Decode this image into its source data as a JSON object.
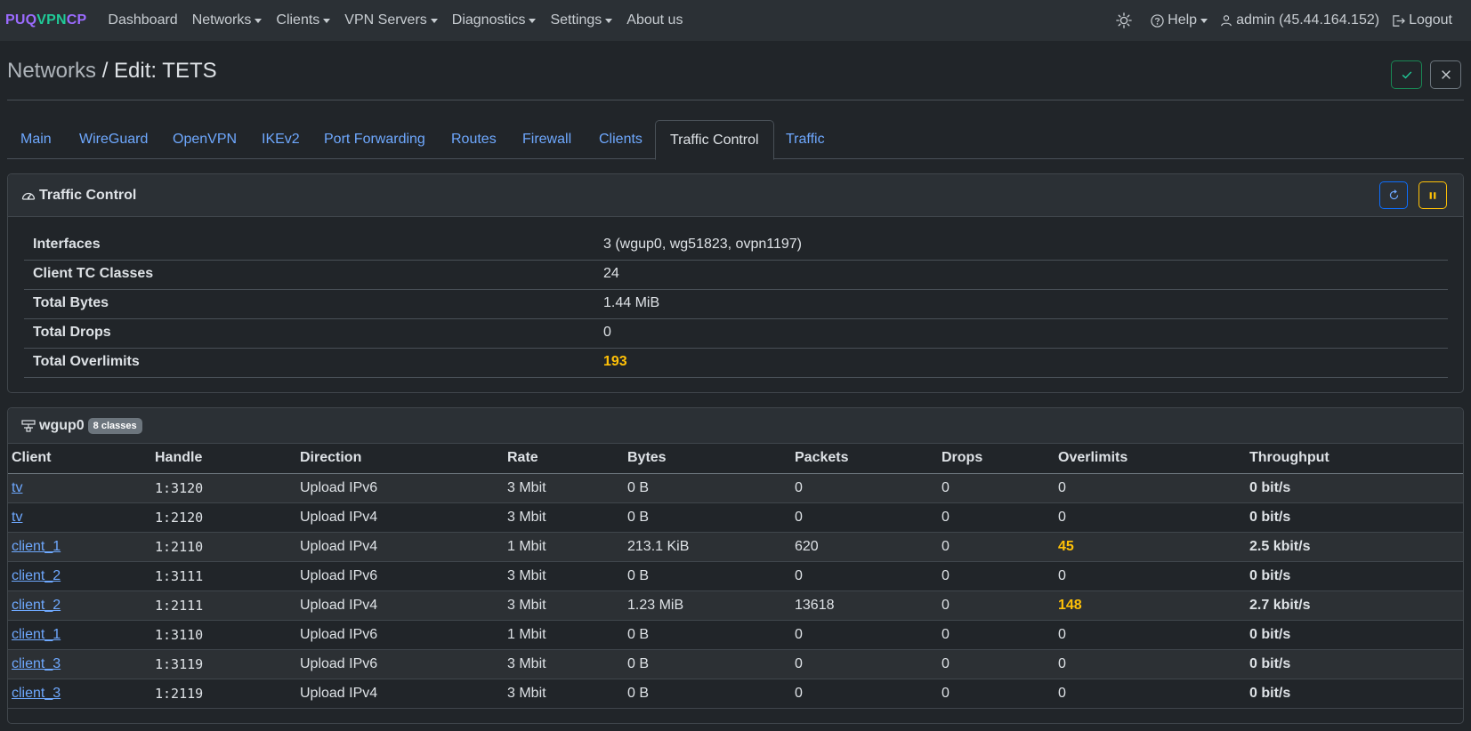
{
  "brand": {
    "puq": "PUQ",
    "vpn": "VPN",
    "cp": "CP"
  },
  "nav": {
    "items": [
      {
        "label": "Dashboard",
        "dropdown": false
      },
      {
        "label": "Networks",
        "dropdown": true
      },
      {
        "label": "Clients",
        "dropdown": true
      },
      {
        "label": "VPN Servers",
        "dropdown": true
      },
      {
        "label": "Diagnostics",
        "dropdown": true
      },
      {
        "label": "Settings",
        "dropdown": true
      },
      {
        "label": "About us",
        "dropdown": false
      }
    ],
    "help": "Help",
    "user": "admin (45.44.164.152)",
    "logout": "Logout"
  },
  "page": {
    "breadcrumb_parent": "Networks",
    "breadcrumb_current": " / Edit: TETS"
  },
  "tabs": [
    {
      "label": "Main",
      "active": false
    },
    {
      "label": "WireGuard",
      "active": false
    },
    {
      "label": "OpenVPN",
      "active": false
    },
    {
      "label": "IKEv2",
      "active": false
    },
    {
      "label": "Port Forwarding",
      "active": false
    },
    {
      "label": "Routes",
      "active": false
    },
    {
      "label": "Firewall",
      "active": false
    },
    {
      "label": "Clients",
      "active": false
    },
    {
      "label": "Traffic Control",
      "active": true
    },
    {
      "label": "Traffic",
      "active": false
    }
  ],
  "traffic_control": {
    "title": "Traffic Control",
    "summary": [
      {
        "key": "Interfaces",
        "value": "3 (wgup0, wg51823, ovpn1197)",
        "warn": false
      },
      {
        "key": "Client TC Classes",
        "value": "24",
        "warn": false
      },
      {
        "key": "Total Bytes",
        "value": "1.44 MiB",
        "warn": false
      },
      {
        "key": "Total Drops",
        "value": "0",
        "warn": false
      },
      {
        "key": "Total Overlimits",
        "value": "193",
        "warn": true
      }
    ]
  },
  "interface_card": {
    "name": "wgup0",
    "badge": "8 classes",
    "columns": [
      "Client",
      "Handle",
      "Direction",
      "Rate",
      "Bytes",
      "Packets",
      "Drops",
      "Overlimits",
      "Throughput"
    ],
    "rows": [
      {
        "client": "tv",
        "handle": "1:3120",
        "direction": "Upload IPv6",
        "rate": "3 Mbit",
        "bytes": "0 B",
        "packets": "0",
        "drops": "0",
        "overlimits": "0",
        "over_warn": false,
        "throughput": "0 bit/s"
      },
      {
        "client": "tv",
        "handle": "1:2120",
        "direction": "Upload IPv4",
        "rate": "3 Mbit",
        "bytes": "0 B",
        "packets": "0",
        "drops": "0",
        "overlimits": "0",
        "over_warn": false,
        "throughput": "0 bit/s"
      },
      {
        "client": "client_1",
        "handle": "1:2110",
        "direction": "Upload IPv4",
        "rate": "1 Mbit",
        "bytes": "213.1 KiB",
        "packets": "620",
        "drops": "0",
        "overlimits": "45",
        "over_warn": true,
        "throughput": "2.5 kbit/s"
      },
      {
        "client": "client_2",
        "handle": "1:3111",
        "direction": "Upload IPv6",
        "rate": "3 Mbit",
        "bytes": "0 B",
        "packets": "0",
        "drops": "0",
        "overlimits": "0",
        "over_warn": false,
        "throughput": "0 bit/s"
      },
      {
        "client": "client_2",
        "handle": "1:2111",
        "direction": "Upload IPv4",
        "rate": "3 Mbit",
        "bytes": "1.23 MiB",
        "packets": "13618",
        "drops": "0",
        "overlimits": "148",
        "over_warn": true,
        "throughput": "2.7 kbit/s"
      },
      {
        "client": "client_1",
        "handle": "1:3110",
        "direction": "Upload IPv6",
        "rate": "1 Mbit",
        "bytes": "0 B",
        "packets": "0",
        "drops": "0",
        "overlimits": "0",
        "over_warn": false,
        "throughput": "0 bit/s"
      },
      {
        "client": "client_3",
        "handle": "1:3119",
        "direction": "Upload IPv6",
        "rate": "3 Mbit",
        "bytes": "0 B",
        "packets": "0",
        "drops": "0",
        "overlimits": "0",
        "over_warn": false,
        "throughput": "0 bit/s"
      },
      {
        "client": "client_3",
        "handle": "1:2119",
        "direction": "Upload IPv4",
        "rate": "3 Mbit",
        "bytes": "0 B",
        "packets": "0",
        "drops": "0",
        "overlimits": "0",
        "over_warn": false,
        "throughput": "0 bit/s"
      }
    ]
  },
  "icons": {
    "theme": "sun-icon",
    "help": "question-circle-icon",
    "user": "person-icon",
    "logout": "logout-icon",
    "save": "check-icon",
    "close": "x-icon",
    "speedometer": "speedometer-icon",
    "refresh": "refresh-icon",
    "pause": "pause-icon",
    "interface": "network-icon"
  },
  "colors": {
    "brand_purple": "#9b6bff",
    "brand_green": "#20c997",
    "link": "#6ea8fe",
    "warning": "#ffc107",
    "success": "#198754",
    "primary": "#0d6efd"
  }
}
